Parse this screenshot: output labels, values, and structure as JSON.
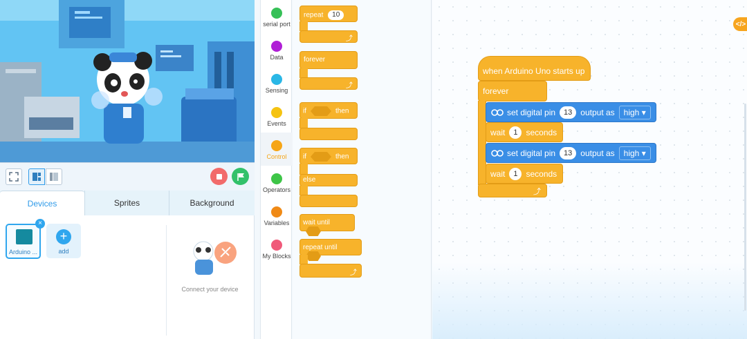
{
  "stage": {
    "colors": {
      "sky": "#5cc2f3",
      "panda_body": "#2f7fcf"
    }
  },
  "controls": {
    "stop_color": "#f26b6b",
    "go_color": "#33c16a"
  },
  "device_tabs": [
    "Devices",
    "Sprites",
    "Background"
  ],
  "devices": [
    {
      "label": "Arduino ...",
      "icon": "arduino-board-icon"
    }
  ],
  "add_label": "add",
  "connect_text": "Connect your device",
  "categories": [
    {
      "label": "serial port",
      "color": "#36c057"
    },
    {
      "label": "Data",
      "color": "#b01fd6"
    },
    {
      "label": "Sensing",
      "color": "#2ab7e6"
    },
    {
      "label": "Events",
      "color": "#f5c311"
    },
    {
      "label": "Control",
      "color": "#f6a516",
      "active": true
    },
    {
      "label": "Operators",
      "color": "#3ec547"
    },
    {
      "label": "Variables",
      "color": "#f08a16"
    },
    {
      "label": "My Blocks",
      "color": "#f05a7a"
    }
  ],
  "palette": {
    "repeat_label": "repeat",
    "repeat_value": "10",
    "forever_label": "forever",
    "if_then_if": "if",
    "if_then_then": "then",
    "if_else_if": "if",
    "if_else_then": "then",
    "if_else_else": "else",
    "wait_until_label": "wait until",
    "repeat_until_label": "repeat until"
  },
  "script": {
    "hat": "when Arduino Uno starts up",
    "forever": "forever",
    "set_pin_1": {
      "text": "set digital pin",
      "pin": "13",
      "output": "output as",
      "value": "high"
    },
    "wait_1": {
      "text": "wait",
      "value": "1",
      "unit": "seconds"
    },
    "set_pin_2": {
      "text": "set digital pin",
      "pin": "13",
      "output": "output as",
      "value": "high"
    },
    "wait_2": {
      "text": "wait",
      "value": "1",
      "unit": "seconds"
    }
  },
  "code_tab_label": "</>"
}
